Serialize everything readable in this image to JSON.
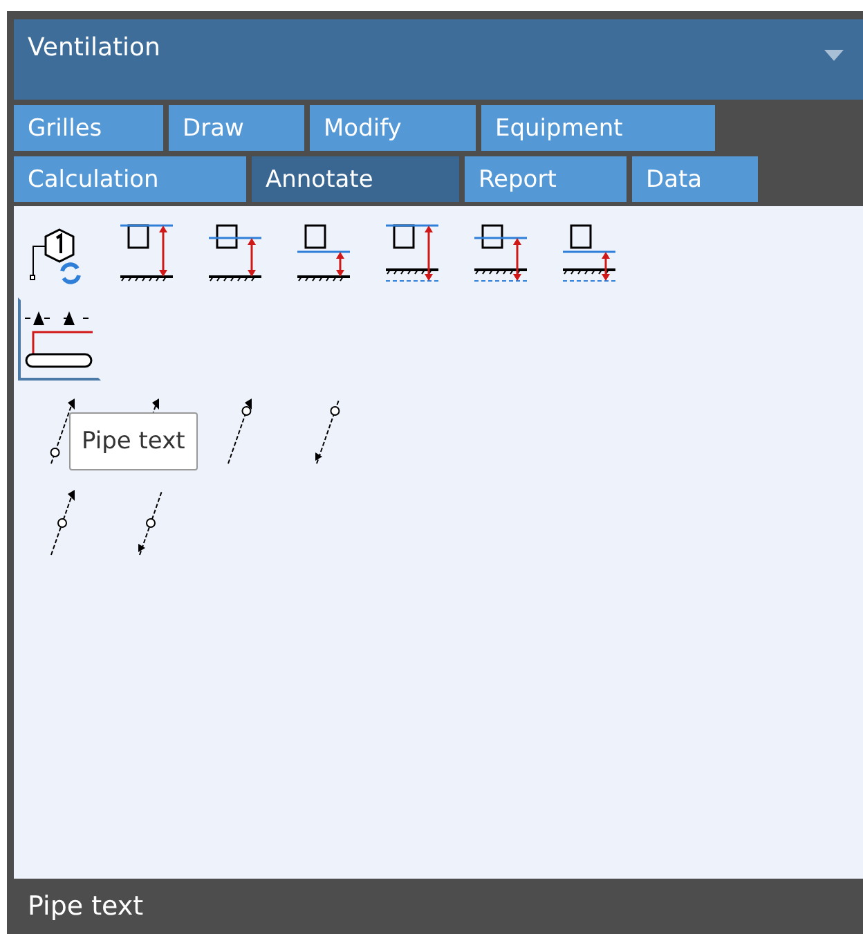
{
  "panel": {
    "title": "Ventilation"
  },
  "tab_rows": [
    [
      {
        "label": "Grilles",
        "selected": false
      },
      {
        "label": "Draw",
        "selected": false
      },
      {
        "label": "Modify",
        "selected": false
      },
      {
        "label": "Equipment",
        "selected": false
      }
    ],
    [
      {
        "label": "Calculation",
        "selected": false
      },
      {
        "label": "Annotate",
        "selected": true
      },
      {
        "label": "Report",
        "selected": false
      },
      {
        "label": "Data",
        "selected": false
      }
    ]
  ],
  "tools": [
    {
      "kind": "tag",
      "selected": false
    },
    {
      "kind": "top",
      "selected": false
    },
    {
      "kind": "middle",
      "selected": false
    },
    {
      "kind": "bottom",
      "selected": false
    },
    {
      "kind": "topwater",
      "selected": false
    },
    {
      "kind": "middlewater",
      "selected": false
    },
    {
      "kind": "bottomwater",
      "selected": false
    },
    {
      "kind": "section",
      "selected": true
    }
  ],
  "tooltip": "Pipe text",
  "status_bar": "Pipe text"
}
